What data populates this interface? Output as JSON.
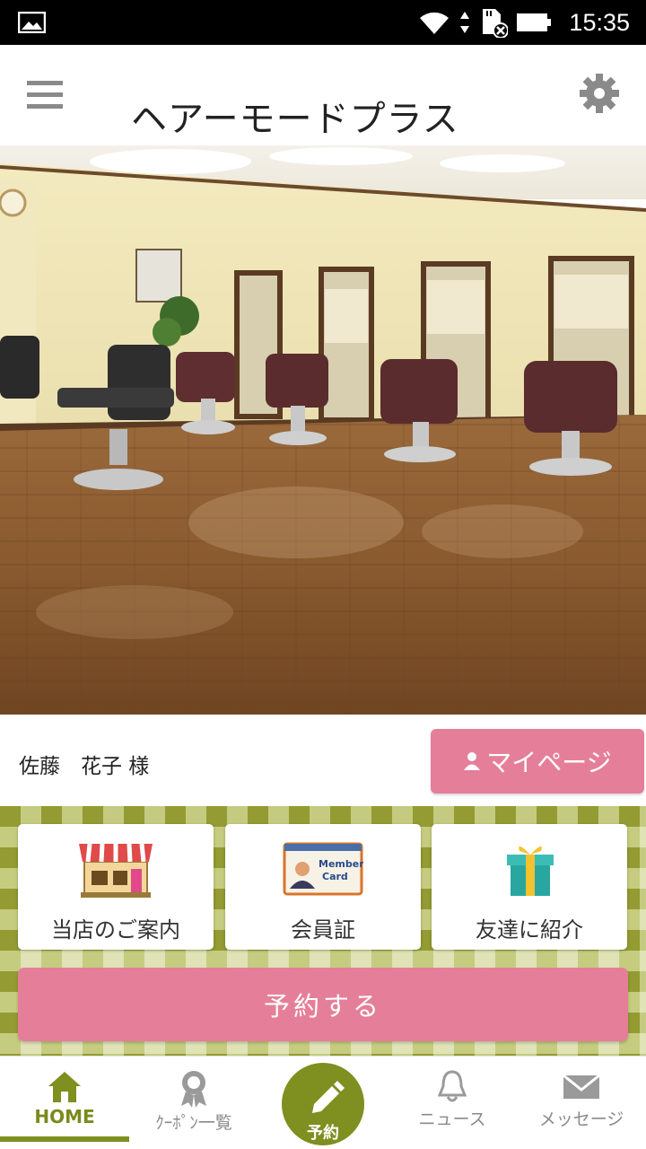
{
  "status_bar": {
    "time": "15:35",
    "icons": [
      "gallery-icon",
      "wifi-icon",
      "data-arrows-icon",
      "sd-card-icon",
      "battery-icon"
    ]
  },
  "header": {
    "title": "ヘアーモードプラス",
    "menu_icon": "menu-icon",
    "settings_icon": "gear-icon"
  },
  "hero": {
    "image": "salon-interior-photo"
  },
  "user": {
    "name": "佐藤　花子 様",
    "mypage_label": "マイページ",
    "mypage_icon": "person-icon"
  },
  "cards": [
    {
      "label": "当店のご案内",
      "icon": "shop-icon"
    },
    {
      "label": "会員証",
      "icon": "members-card-icon",
      "icon_text_1": "Members",
      "icon_text_2": "Card"
    },
    {
      "label": "友達に紹介",
      "icon": "gift-icon"
    }
  ],
  "reserve_button": {
    "label": "予約する"
  },
  "bottom_nav": {
    "home": "HOME",
    "coupon": "ｸｰﾎﾟﾝ一覧",
    "reserve": "予約",
    "news": "ニュース",
    "message": "メッセージ"
  },
  "colors": {
    "accent_pink": "#e57f99",
    "accent_green": "#7f8f20",
    "checker_light": "#c9d08a",
    "checker_dark": "#9aa23a"
  }
}
